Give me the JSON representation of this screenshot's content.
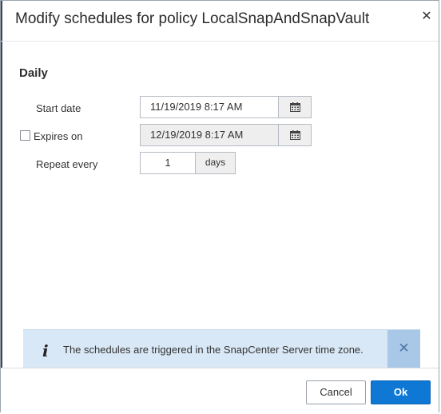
{
  "dialog": {
    "title": "Modify schedules for policy LocalSnapAndSnapVault",
    "close_icon": "close-icon"
  },
  "schedule": {
    "section_title": "Daily",
    "start_date": {
      "label": "Start date",
      "value": "11/19/2019 8:17 AM",
      "icon": "calendar-icon"
    },
    "expires_on": {
      "label": "Expires on",
      "checked": false,
      "value": "12/19/2019 8:17 AM",
      "disabled": true,
      "icon": "calendar-icon"
    },
    "repeat_every": {
      "label": "Repeat every",
      "value": "1",
      "unit": "days"
    }
  },
  "info": {
    "icon": "info-icon",
    "text": "The schedules are triggered in the SnapCenter Server time zone.",
    "dismiss_icon": "close-icon"
  },
  "footer": {
    "cancel_label": "Cancel",
    "ok_label": "Ok"
  },
  "colors": {
    "primary_button": "#0f78d4",
    "info_background": "#d9e8f6",
    "info_dismiss": "#a9c7e6"
  }
}
